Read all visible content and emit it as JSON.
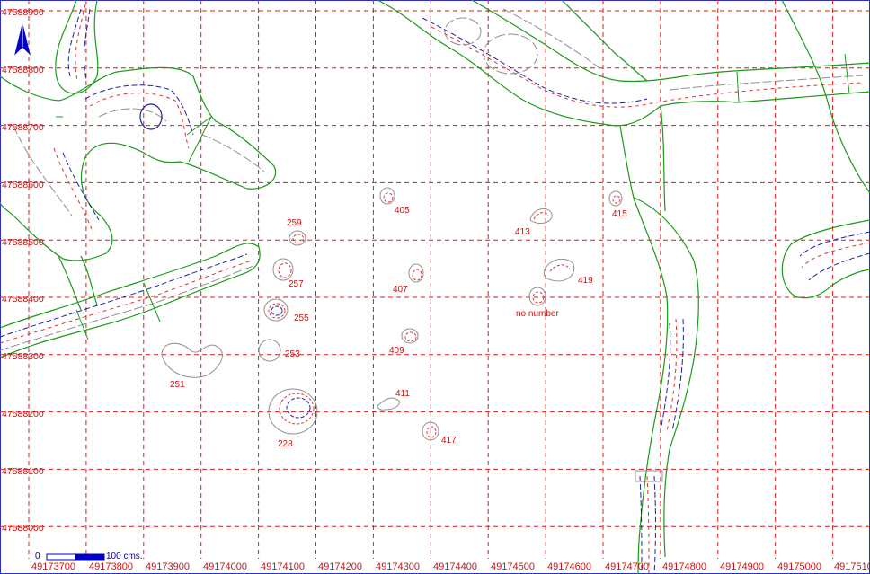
{
  "map": {
    "colors": {
      "grid": "#d81c1c",
      "channel": "#1a9a1a",
      "contour_gray": "#909090",
      "contour_red": "#e03030",
      "contour_blue": "#2020a0",
      "label": "#d01010",
      "scale": "#0000c8"
    },
    "north_arrow_icon": "north-arrow-icon",
    "scale_bar": {
      "start_label": "0",
      "end_label": "100 cms."
    },
    "y_axis_labels": [
      "47588900",
      "47588800",
      "47588700",
      "47588600",
      "47588500",
      "47588400",
      "47588300",
      "47588200",
      "47588100",
      "47588000"
    ],
    "x_axis_labels": [
      "49173700",
      "49173800",
      "49173900",
      "49174000",
      "49174100",
      "49174200",
      "49174300",
      "49174400",
      "49174500",
      "49174600",
      "49174700",
      "49174800",
      "49174900",
      "49175000",
      "4917510"
    ],
    "features": [
      {
        "label": "405"
      },
      {
        "label": "413"
      },
      {
        "label": "415"
      },
      {
        "label": "259"
      },
      {
        "label": "257"
      },
      {
        "label": "407"
      },
      {
        "label": "419"
      },
      {
        "label": "no number"
      },
      {
        "label": "255"
      },
      {
        "label": "253"
      },
      {
        "label": "409"
      },
      {
        "label": "251"
      },
      {
        "label": "411"
      },
      {
        "label": "228"
      },
      {
        "label": "417"
      }
    ]
  }
}
